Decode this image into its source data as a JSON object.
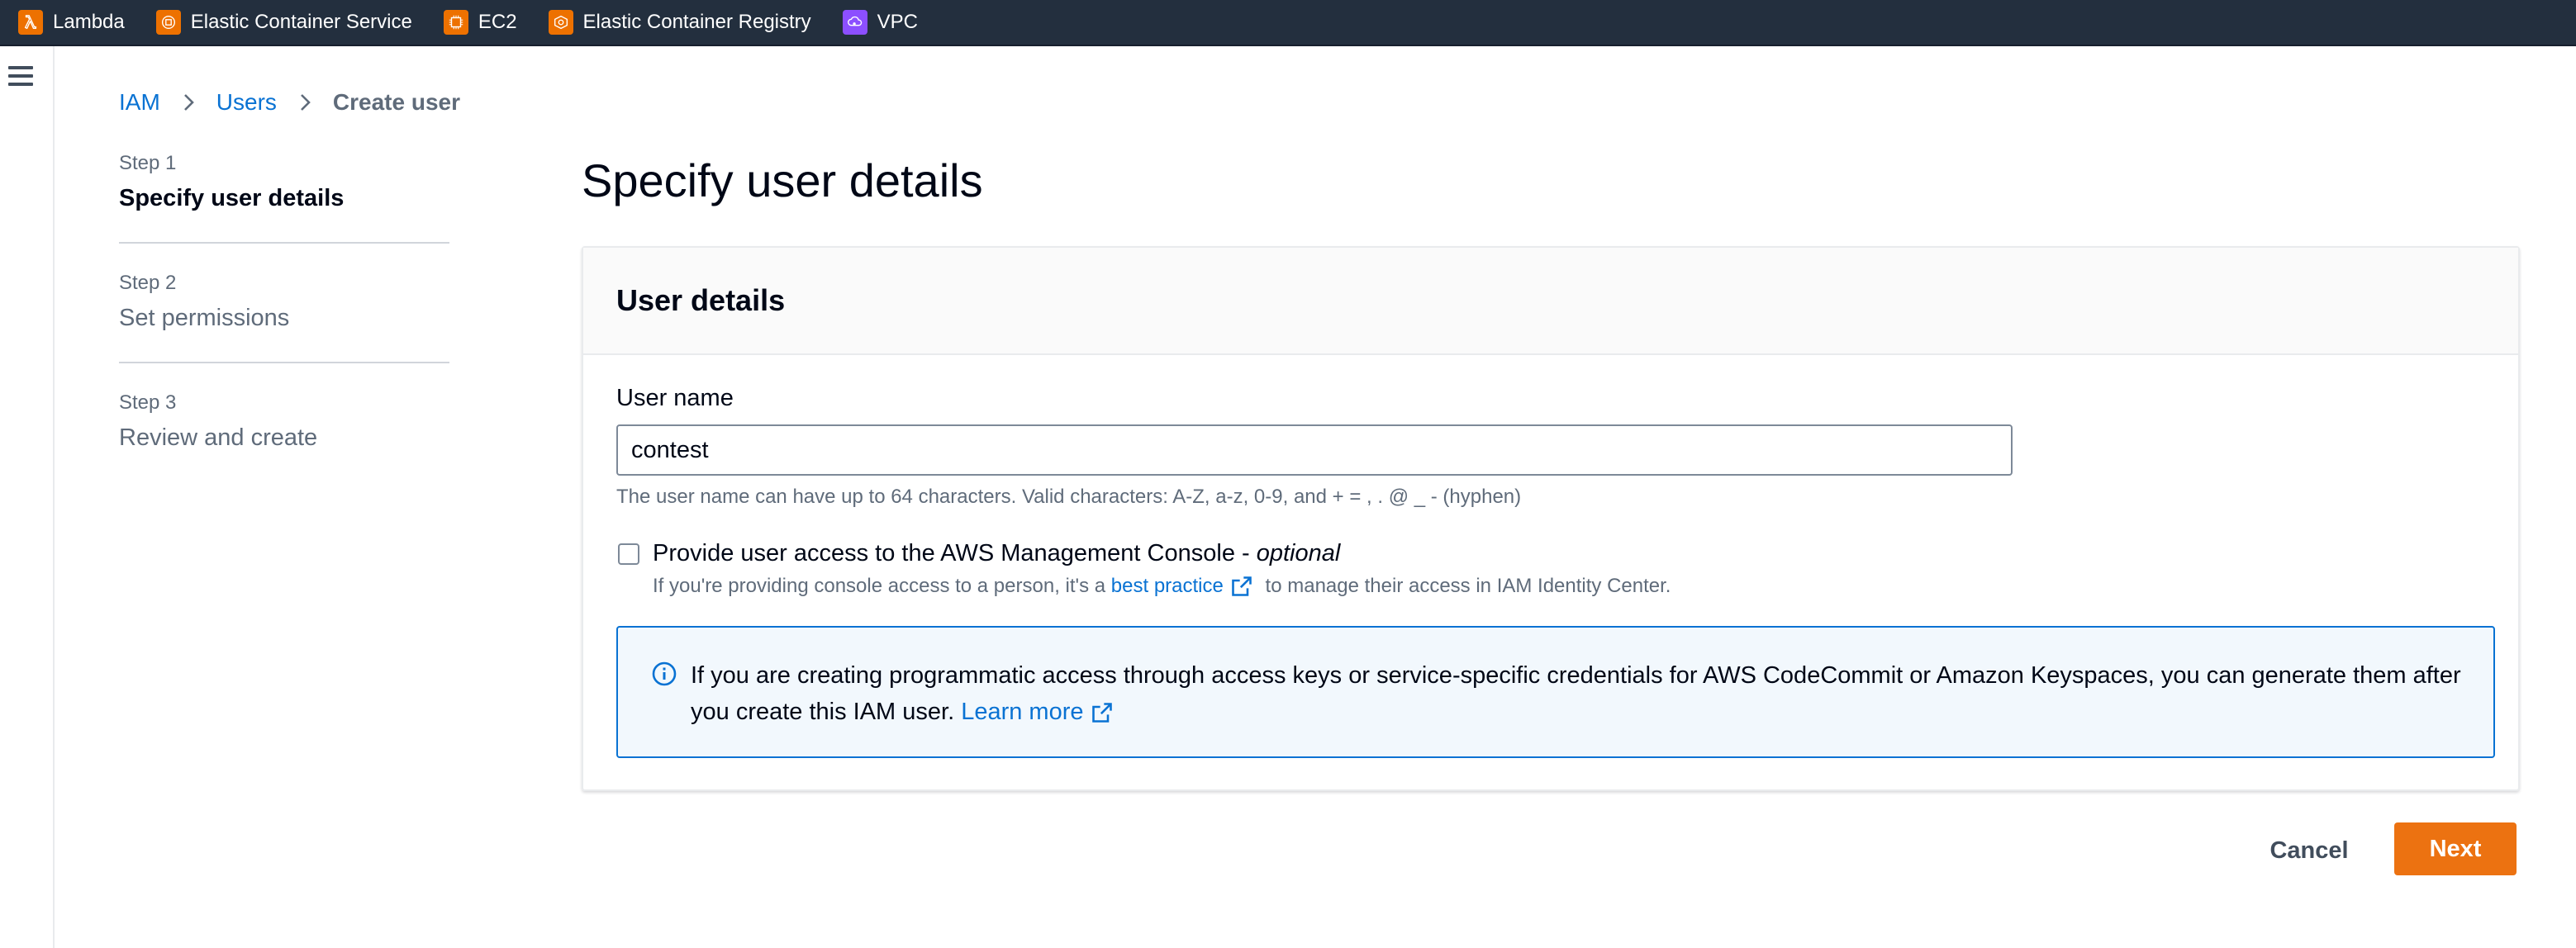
{
  "topbar": {
    "services": [
      {
        "label": "Lambda",
        "icon": "lambda-icon",
        "color": "#ed7100"
      },
      {
        "label": "Elastic Container Service",
        "icon": "ecs-icon",
        "color": "#ed7100"
      },
      {
        "label": "EC2",
        "icon": "ec2-icon",
        "color": "#ed7100"
      },
      {
        "label": "Elastic Container Registry",
        "icon": "ecr-icon",
        "color": "#ed7100"
      },
      {
        "label": "VPC",
        "icon": "vpc-icon",
        "color": "#8c4fff"
      }
    ]
  },
  "breadcrumb": {
    "items": [
      "IAM",
      "Users"
    ],
    "current": "Create user"
  },
  "steps": [
    {
      "num": "Step 1",
      "title": "Specify user details",
      "active": true
    },
    {
      "num": "Step 2",
      "title": "Set permissions",
      "active": false
    },
    {
      "num": "Step 3",
      "title": "Review and create",
      "active": false
    }
  ],
  "page": {
    "title": "Specify user details"
  },
  "user_details": {
    "header": "User details",
    "username_label": "User name",
    "username_value": "contest",
    "username_hint": "The user name can have up to 64 characters. Valid characters: A-Z, a-z, 0-9, and + = , . @ _ - (hyphen)",
    "console_access_label": "Provide user access to the AWS Management Console - ",
    "console_access_optional": "optional",
    "console_access_checked": false,
    "console_desc_prefix": "If you're providing console access to a person, it's a ",
    "console_desc_link": "best practice",
    "console_desc_suffix": " to manage their access in IAM Identity Center.",
    "info_text": "If you are creating programmatic access through access keys or service-specific credentials for AWS CodeCommit or Amazon Keyspaces, you can generate them after you create this IAM user. ",
    "info_link": "Learn more"
  },
  "actions": {
    "cancel": "Cancel",
    "next": "Next"
  },
  "colors": {
    "topbar_bg": "#232f3e",
    "link": "#0972d3",
    "primary_button": "#ec7211",
    "info_border": "#0972d3",
    "info_bg": "#f2f8fd"
  }
}
